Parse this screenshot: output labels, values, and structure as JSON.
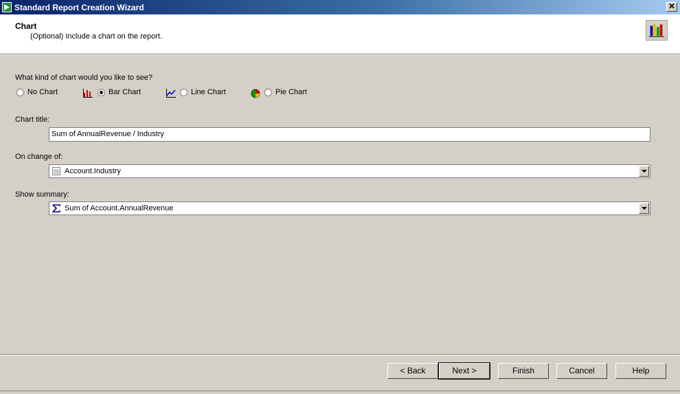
{
  "window": {
    "title": "Standard Report Creation Wizard",
    "close_glyph": "✕"
  },
  "header": {
    "title": "Chart",
    "subtitle": "(Optional) Include a chart on the report."
  },
  "chart_type": {
    "question": "What kind of chart would you like to see?",
    "options": [
      {
        "label": "No Chart",
        "selected": false
      },
      {
        "label": "Bar Chart",
        "selected": true
      },
      {
        "label": "Line Chart",
        "selected": false
      },
      {
        "label": "Pie Chart",
        "selected": false
      }
    ]
  },
  "chart_title": {
    "label": "Chart title:",
    "value": "Sum of AnnualRevenue / Industry"
  },
  "on_change_of": {
    "label": "On change of:",
    "value": "Account.Industry"
  },
  "show_summary": {
    "label": "Show summary:",
    "value": "Sum of Account.AnnualRevenue"
  },
  "buttons": {
    "back": "< Back",
    "next": "Next >",
    "finish": "Finish",
    "cancel": "Cancel",
    "help": "Help"
  }
}
